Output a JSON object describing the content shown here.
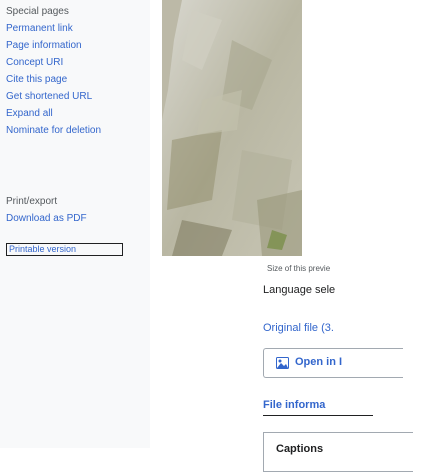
{
  "sidebar": {
    "special_heading": "Special pages",
    "links": [
      "Permanent link",
      "Page information",
      "Concept URI",
      "Cite this page",
      "Get shortened URL",
      "Expand all",
      "Nominate for deletion"
    ],
    "print_heading": "Print/export",
    "download_pdf": "Download as PDF",
    "printable_version": "Printable version"
  },
  "main": {
    "image_caption": "Size of this previe",
    "language_select": "Language sele",
    "original_file": "Original file (3.",
    "open_button": "Open in I",
    "file_information_tab": "File informa",
    "captions_label": "Captions"
  },
  "colors": {
    "link": "#3366cc",
    "text": "#202122",
    "sidebar_bg": "#f8f9fa"
  },
  "icons": {
    "open_icon": "image-icon"
  }
}
